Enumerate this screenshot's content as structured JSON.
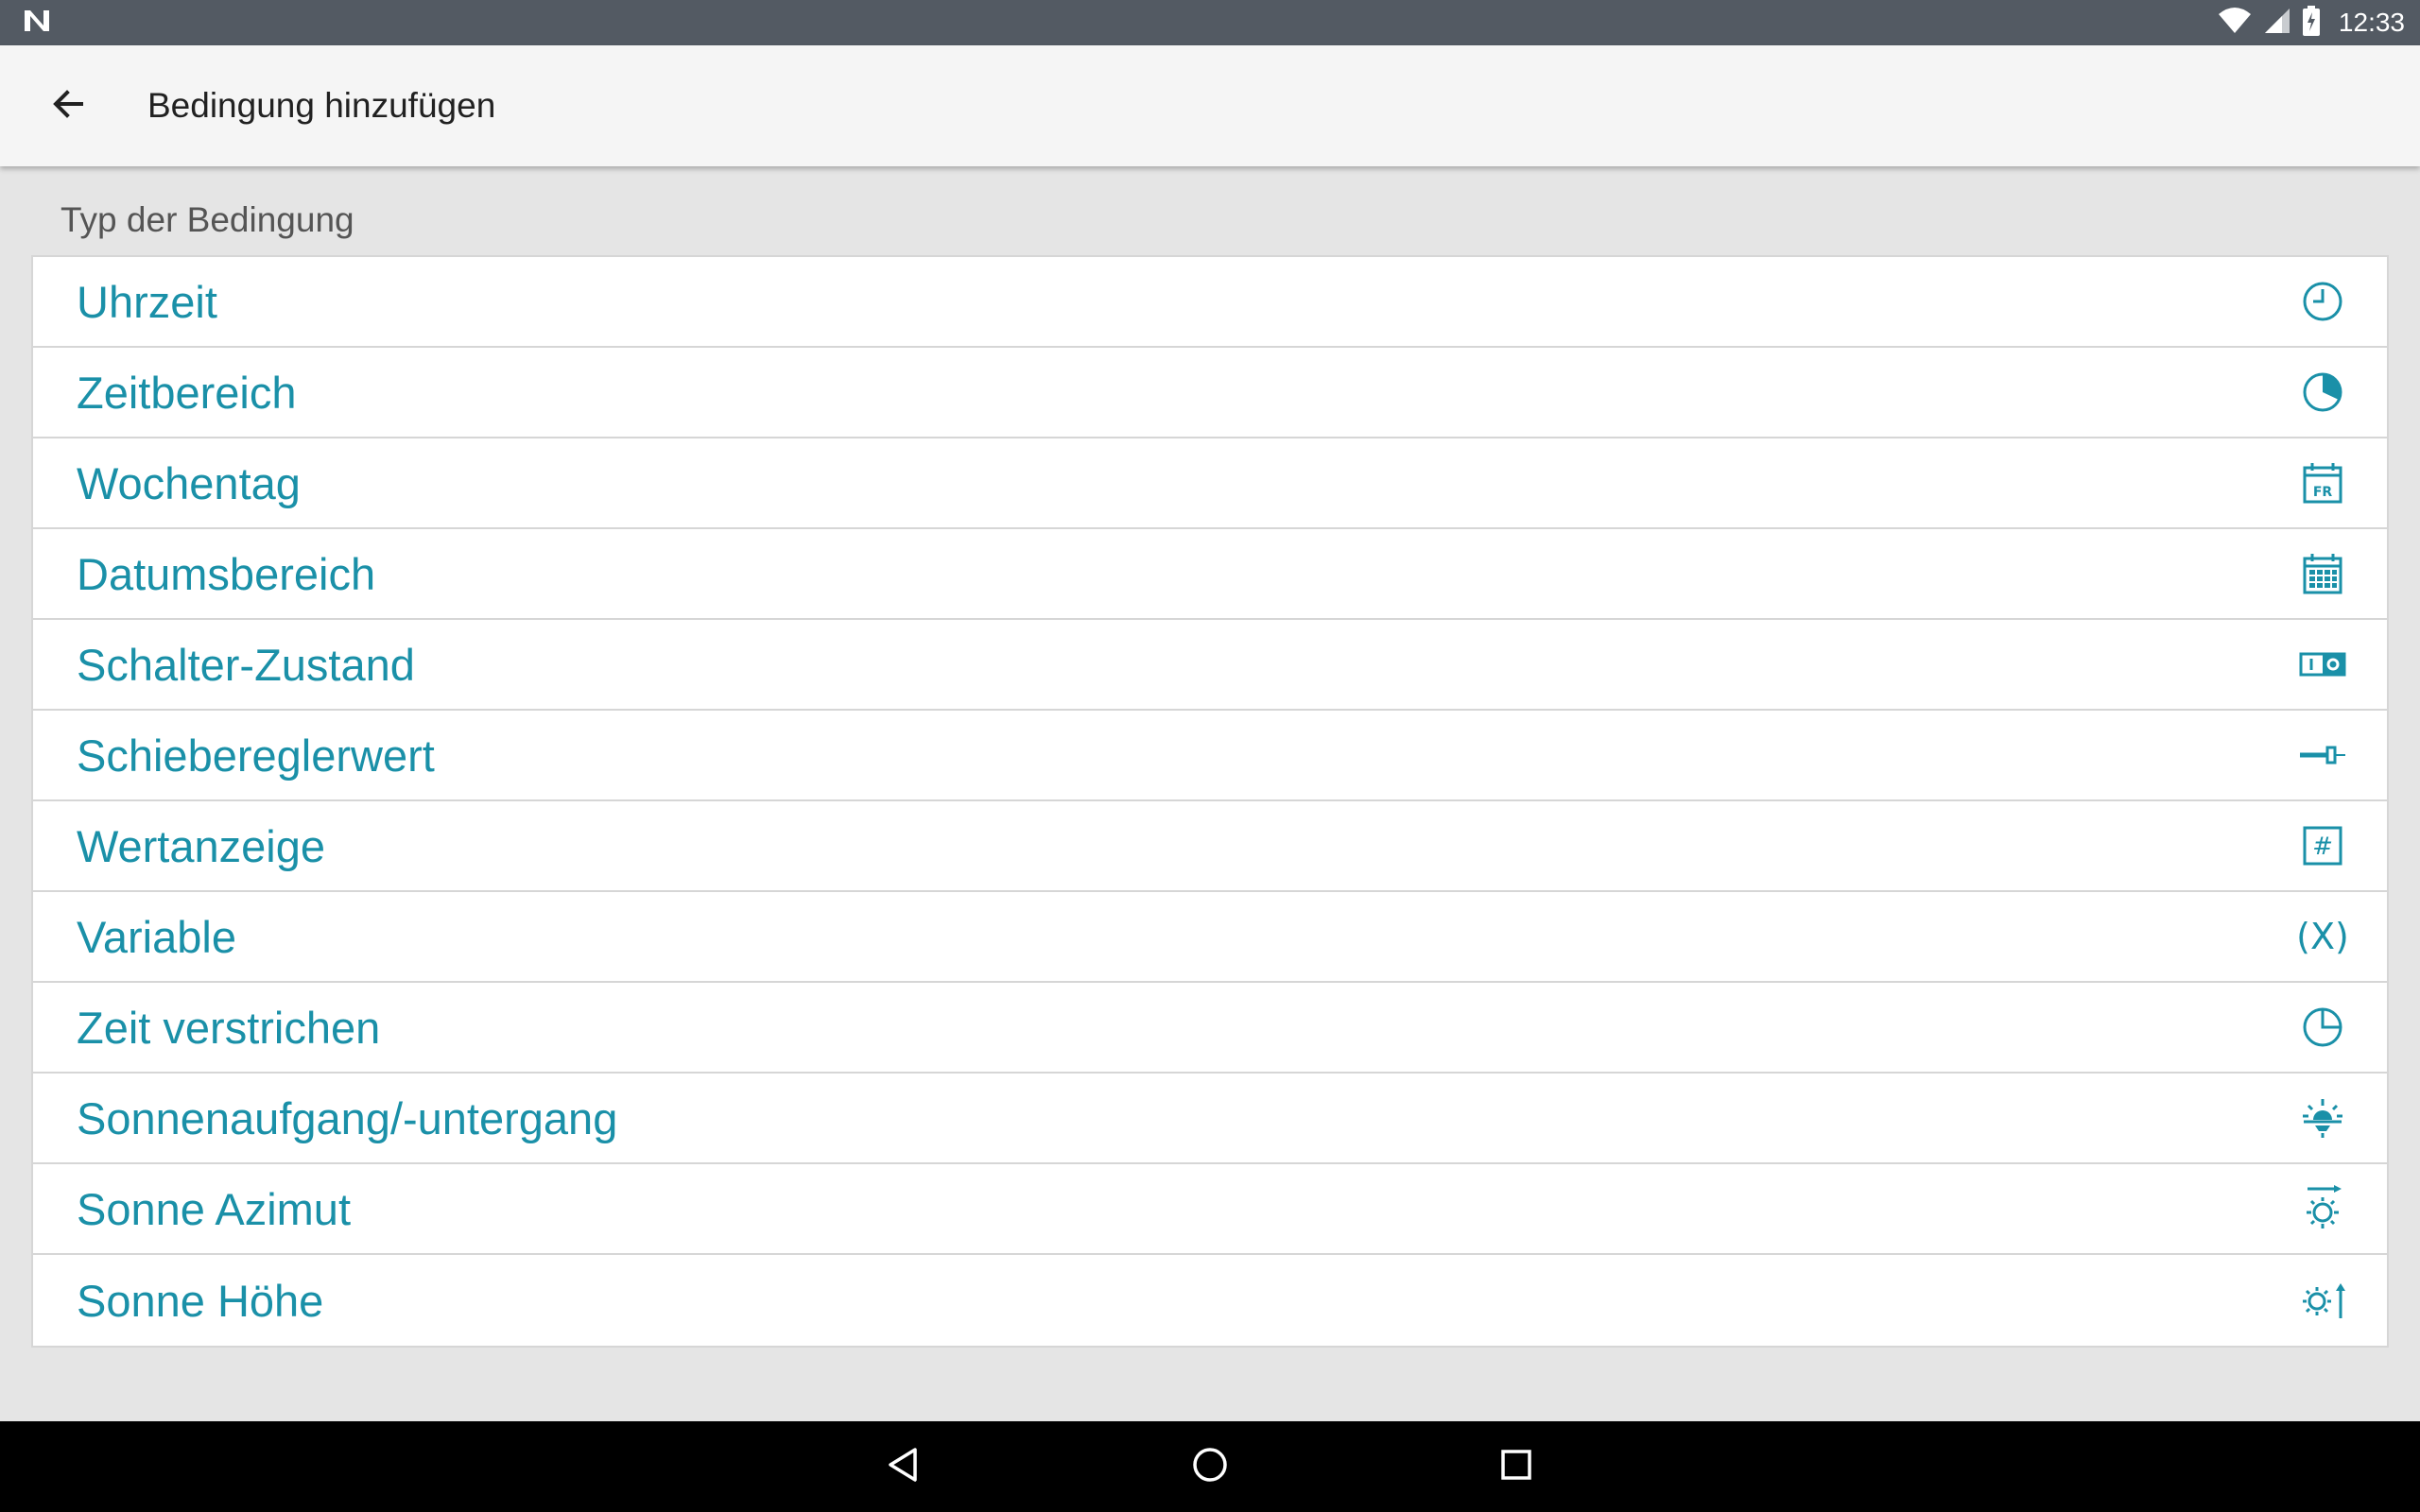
{
  "status_bar": {
    "time": "12:33",
    "notification_icon": "n-logo-icon",
    "icons": [
      "wifi-icon",
      "signal-icon",
      "battery-icon"
    ]
  },
  "app_bar": {
    "back_icon": "arrow-back-icon",
    "title": "Bedingung hinzufügen"
  },
  "section_header": "Typ der Bedingung",
  "items": [
    {
      "label": "Uhrzeit",
      "icon": "clock-icon"
    },
    {
      "label": "Zeitbereich",
      "icon": "time-range-icon"
    },
    {
      "label": "Wochentag",
      "icon": "calendar-weekday-icon",
      "icon_text": "FR"
    },
    {
      "label": "Datumsbereich",
      "icon": "calendar-range-icon"
    },
    {
      "label": "Schalter-Zustand",
      "icon": "switch-state-icon"
    },
    {
      "label": "Schiebereglerwert",
      "icon": "slider-icon"
    },
    {
      "label": "Wertanzeige",
      "icon": "hash-box-icon",
      "icon_text": "#"
    },
    {
      "label": "Variable",
      "icon": "variable-icon",
      "icon_text": "(X)"
    },
    {
      "label": "Zeit verstrichen",
      "icon": "elapsed-time-icon"
    },
    {
      "label": "Sonnenaufgang/-untergang",
      "icon": "sunrise-icon"
    },
    {
      "label": "Sonne Azimut",
      "icon": "sun-azimuth-icon"
    },
    {
      "label": "Sonne Höhe",
      "icon": "sun-elevation-icon"
    }
  ],
  "nav_bar": {
    "buttons": [
      "nav-back-icon",
      "nav-home-icon",
      "nav-recents-icon"
    ]
  },
  "colors": {
    "accent": "#1a90a8",
    "status_bar": "#535a63",
    "app_bar": "#f5f5f5",
    "background": "#e5e5e5"
  }
}
